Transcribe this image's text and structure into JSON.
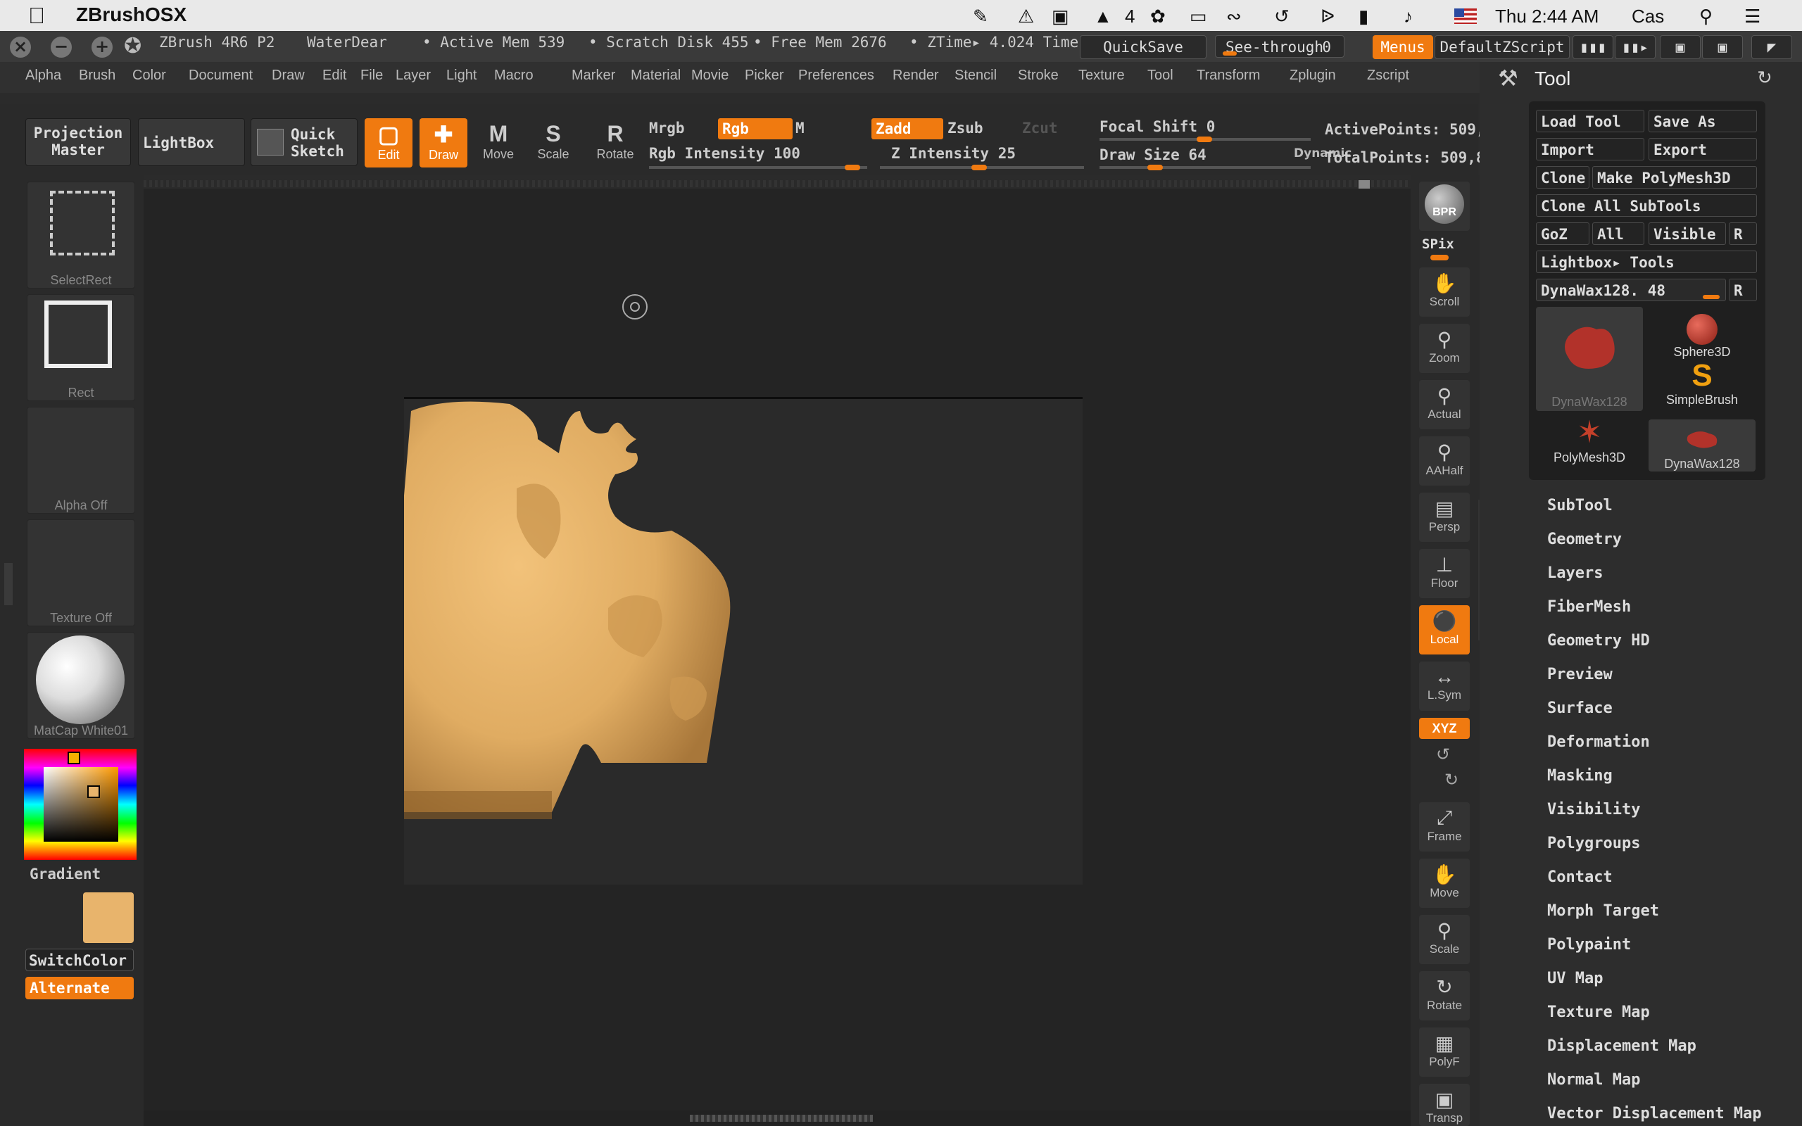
{
  "macbar": {
    "app_name": "ZBrushOSX",
    "clock": "Thu 2:44 AM",
    "user": "Cas",
    "adobe_count": "4"
  },
  "title": {
    "version": "ZBrush 4R6 P2",
    "document": "WaterDear",
    "active_mem": "• Active Mem 539",
    "scratch": "• Scratch Disk 455",
    "free_mem": "• Free Mem 2676",
    "ztime": "• ZTime▸ 4.024 Time",
    "quicksave": "QuickSave",
    "seethrough": "See-through",
    "seethrough_val": "0",
    "menus": "Menus",
    "default_zscript": "DefaultZScript"
  },
  "menu_items": [
    "Alpha",
    "Brush",
    "Color",
    "Document",
    "Draw",
    "Edit",
    "File",
    "Layer",
    "Light",
    "Macro",
    "Marker",
    "Material",
    "Movie",
    "Picker",
    "Preferences",
    "Render",
    "Stencil",
    "Stroke",
    "Texture",
    "Tool",
    "Transform",
    "Zplugin",
    "Zscript"
  ],
  "toolbar": {
    "projection_master": [
      "Projection",
      "Master"
    ],
    "lightbox": "LightBox",
    "quick_sketch": [
      "Quick",
      "Sketch"
    ],
    "edit": "Edit",
    "draw": "Draw",
    "move": "Move",
    "scale": "Scale",
    "rotate": "Rotate",
    "mrgb": "Mrgb",
    "rgb": "Rgb",
    "m": "M",
    "rgb_intensity": "Rgb Intensity 100",
    "zadd": "Zadd",
    "zsub": "Zsub",
    "zcut": "Zcut",
    "z_intensity": "Z Intensity 25",
    "focal_shift": "Focal Shift 0",
    "draw_size": "Draw Size 64",
    "dynamic": "Dynamic",
    "active_points": "ActivePoints: 509,",
    "total_points": "TotalPoints: 509,8",
    "rgb_intensity_value": 100,
    "z_intensity_value": 25,
    "draw_size_value": 64
  },
  "left": {
    "select_rect": "SelectRect",
    "rect": "Rect",
    "alpha": "Alpha  Off",
    "texture": "Texture  Off",
    "matcap": "MatCap  White01",
    "gradient": "Gradient",
    "switch_color": "SwitchColor",
    "alternate": "Alternate",
    "main_color": "#e8b46c",
    "secondary_color": "#2a2a2a"
  },
  "shelf": {
    "bpr": "BPR",
    "spix": "SPix",
    "scroll": "Scroll",
    "zoom": "Zoom",
    "actual": "Actual",
    "aahalf": "AAHalf",
    "persp": "Persp",
    "floor": "Floor",
    "local": "Local",
    "lsym": "L.Sym",
    "xyz": "XYZ",
    "frame": "Frame",
    "move": "Move",
    "scale": "Scale",
    "rotate": "Rotate",
    "polyf": "PolyF",
    "transp": "Transp"
  },
  "tool": {
    "title": "Tool",
    "load_tool": "Load Tool",
    "save_as": "Save As",
    "import": "Import",
    "export": "Export",
    "clone": "Clone",
    "make_polymesh": "Make PolyMesh3D",
    "clone_all": "Clone  All  SubTools",
    "goz": "GoZ",
    "all": "All",
    "visible": "Visible",
    "r": "R",
    "lightbox_tools": "Lightbox▸ Tools",
    "current": "DynaWax128. 48",
    "thumbs": [
      "DynaWax128",
      "Sphere3D",
      "SimpleBrush",
      "PolyMesh3D",
      "DynaWax128"
    ],
    "subpalettes": [
      "SubTool",
      "Geometry",
      "Layers",
      "FiberMesh",
      "Geometry HD",
      "Preview",
      "Surface",
      "Deformation",
      "Masking",
      "Visibility",
      "Polygroups",
      "Contact",
      "Morph Target",
      "Polypaint",
      "UV Map",
      "Texture Map",
      "Displacement Map",
      "Normal Map",
      "Vector Displacement Map"
    ]
  },
  "colors": {
    "accent": "#f07a10",
    "clay": "#e0ac62"
  }
}
